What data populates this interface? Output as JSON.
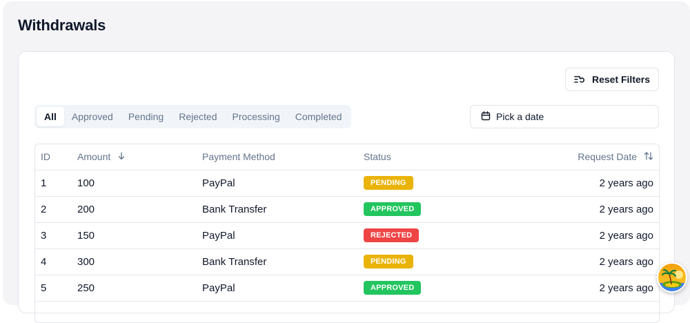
{
  "header": {
    "title": "Withdrawals"
  },
  "toolbar": {
    "reset_label": "Reset Filters",
    "date_placeholder": "Pick a date"
  },
  "tabs": [
    {
      "label": "All",
      "active": true
    },
    {
      "label": "Approved",
      "active": false
    },
    {
      "label": "Pending",
      "active": false
    },
    {
      "label": "Rejected",
      "active": false
    },
    {
      "label": "Processing",
      "active": false
    },
    {
      "label": "Completed",
      "active": false
    }
  ],
  "table": {
    "columns": {
      "id": "ID",
      "amount": "Amount",
      "payment_method": "Payment Method",
      "status": "Status",
      "request_date": "Request Date"
    },
    "rows": [
      {
        "id": "1",
        "amount": "100",
        "payment_method": "PayPal",
        "status": "PENDING",
        "status_color": "#eab308",
        "request_date": "2 years ago"
      },
      {
        "id": "2",
        "amount": "200",
        "payment_method": "Bank Transfer",
        "status": "APPROVED",
        "status_color": "#22c55e",
        "request_date": "2 years ago"
      },
      {
        "id": "3",
        "amount": "150",
        "payment_method": "PayPal",
        "status": "REJECTED",
        "status_color": "#ef4444",
        "request_date": "2 years ago"
      },
      {
        "id": "4",
        "amount": "300",
        "payment_method": "Bank Transfer",
        "status": "PENDING",
        "status_color": "#eab308",
        "request_date": "2 years ago"
      },
      {
        "id": "5",
        "amount": "250",
        "payment_method": "PayPal",
        "status": "APPROVED",
        "status_color": "#22c55e",
        "request_date": "2 years ago"
      }
    ]
  },
  "icons": {
    "reset": "filter-reset-icon",
    "calendar": "calendar-icon",
    "amount_sort": "arrow-down-icon",
    "date_sort": "sort-arrows-icon",
    "floating": "island-avatar-icon"
  }
}
